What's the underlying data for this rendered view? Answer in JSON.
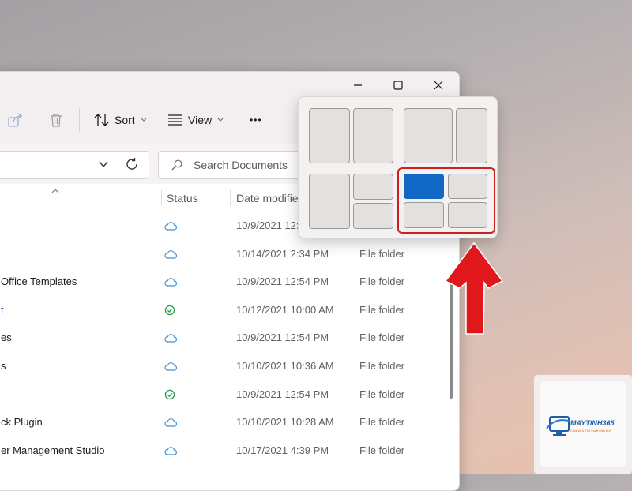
{
  "window": {
    "caption_buttons": [
      "minimize",
      "maximize",
      "close"
    ]
  },
  "toolbar": {
    "sort_label": "Sort",
    "view_label": "View",
    "more_label": "•••"
  },
  "search": {
    "placeholder": "Search Documents"
  },
  "columns": {
    "status": "Status",
    "date_modified": "Date modified"
  },
  "rows": [
    {
      "name": "",
      "status": "cloud",
      "date": "10/9/2021 12:",
      "type": ""
    },
    {
      "name": "",
      "status": "cloud",
      "date": "10/14/2021 2:34 PM",
      "type": "File folder"
    },
    {
      "name": "Office Templates",
      "status": "cloud",
      "date": "10/9/2021 12:54 PM",
      "type": "File folder"
    },
    {
      "name": "t",
      "status": "synced",
      "date": "10/12/2021 10:00 AM",
      "type": "File folder"
    },
    {
      "name": "es",
      "status": "cloud",
      "date": "10/9/2021 12:54 PM",
      "type": "File folder"
    },
    {
      "name": "s",
      "status": "cloud",
      "date": "10/10/2021 10:36 AM",
      "type": "File folder"
    },
    {
      "name": "",
      "status": "synced",
      "date": "10/9/2021 12:54 PM",
      "type": "File folder"
    },
    {
      "name": "ck Plugin",
      "status": "cloud",
      "date": "10/10/2021 10:28 AM",
      "type": "File folder"
    },
    {
      "name": "er Management Studio",
      "status": "cloud",
      "date": "10/17/2021 4:39 PM",
      "type": "File folder"
    }
  ],
  "snap_layouts": {
    "active_zone": "quad-top-left",
    "highlight_color": "#d0201d",
    "accent_color": "#0f67c6"
  },
  "watermark": {
    "brand": "MAYTINH365",
    "tagline": "Chia sẻ & Thủ thuật Máy tính"
  },
  "colors": {
    "cloud_icon": "#3b8fd9",
    "synced_icon": "#1e9e4a",
    "arrow": "#e0171b"
  }
}
